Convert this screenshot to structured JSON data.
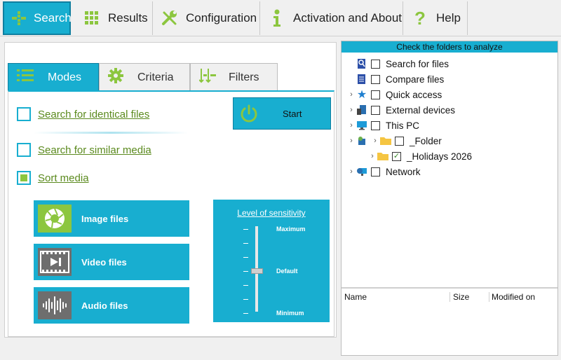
{
  "top_tabs": [
    {
      "label": "Search",
      "icon": "crosshair-grid-icon",
      "active": true
    },
    {
      "label": "Results",
      "icon": "grid-icon",
      "active": false
    },
    {
      "label": "Configuration",
      "icon": "wrench-screwdriver-icon",
      "active": false
    },
    {
      "label": "Activation and About",
      "icon": "info-icon",
      "active": false
    },
    {
      "label": "Help",
      "icon": "question-icon",
      "active": false
    }
  ],
  "sub_tabs": [
    {
      "label": "Modes",
      "icon": "list-icon",
      "active": true
    },
    {
      "label": "Criteria",
      "icon": "gear-icon",
      "active": false
    },
    {
      "label": "Filters",
      "icon": "filter-icon",
      "active": false
    }
  ],
  "modes": {
    "search_identical": {
      "label": "Search for identical files",
      "checked": false
    },
    "search_similar": {
      "label": "Search for similar media",
      "checked": false
    },
    "sort_media": {
      "label": "Sort media",
      "checked": true
    }
  },
  "start_button": {
    "label": "Start",
    "icon": "power-icon"
  },
  "file_types": [
    {
      "label": "Image files",
      "icon": "camera-aperture-icon"
    },
    {
      "label": "Video files",
      "icon": "film-icon"
    },
    {
      "label": "Audio files",
      "icon": "waveform-icon"
    }
  ],
  "sensitivity": {
    "title": "Level of sensitivity",
    "levels": {
      "max": "Maximum",
      "default": "Default",
      "min": "Minimum"
    },
    "current": "Default"
  },
  "folders": {
    "header": "Check the folders to analyze",
    "items": [
      {
        "label": "Search for files",
        "icon": "search-doc-icon",
        "checked": false,
        "expandable": false
      },
      {
        "label": "Compare files",
        "icon": "compare-doc-icon",
        "checked": false,
        "expandable": false
      },
      {
        "label": "Quick access",
        "icon": "star-icon",
        "checked": false,
        "expandable": true
      },
      {
        "label": "External devices",
        "icon": "device-icon",
        "checked": false,
        "expandable": true
      },
      {
        "label": "This PC",
        "icon": "monitor-icon",
        "checked": false,
        "expandable": true
      },
      {
        "label": "_Folder",
        "icon": "folder-icon",
        "checked": false,
        "expandable": true
      },
      {
        "label": "_Holidays 2026",
        "icon": "folder-icon",
        "checked": true,
        "expandable": true
      },
      {
        "label": "Network",
        "icon": "network-icon",
        "checked": false,
        "expandable": true
      }
    ],
    "columns": [
      "Name",
      "Size",
      "Modified on"
    ]
  },
  "colors": {
    "accent": "#18aed0",
    "green": "#8cc63f",
    "link": "#5b8a1e"
  }
}
